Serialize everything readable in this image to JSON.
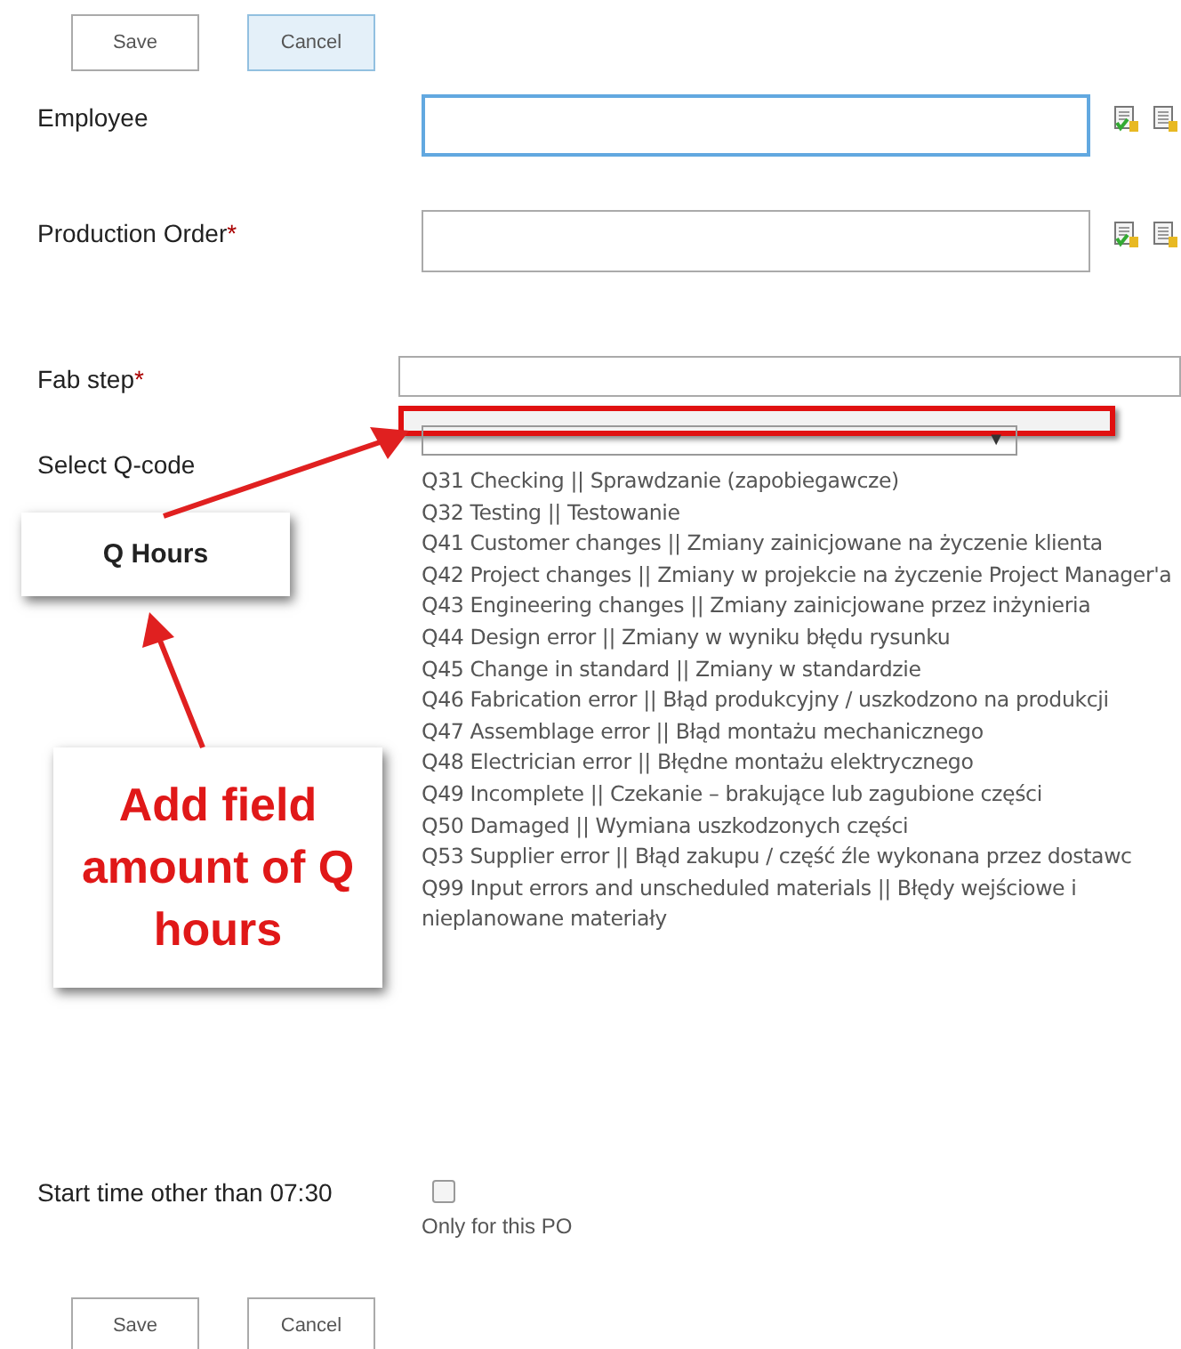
{
  "top_buttons": [
    {
      "label": "Save",
      "hovered": false
    },
    {
      "label": "Cancel",
      "hovered": true
    }
  ],
  "fields": [
    {
      "kind": "people",
      "label": "Employee",
      "focused": true
    },
    {
      "kind": "people",
      "label": "Production Order",
      "required_mark": "*",
      "focused": false
    },
    {
      "kind": "text",
      "label": "Fab step",
      "required_mark": "*",
      "focused": false
    },
    {
      "kind": "choice",
      "label": "Select Q-code",
      "arrow": "▼",
      "options": [
        "Q31 Checking || Sprawdzanie (zapobiegawcze)",
        "Q32 Testing || Testowanie",
        "Q41 Customer changes || Zmiany zainicjowane na życzenie klienta",
        "Q42 Project changes || Zmiany w projekcie na życzenie Project Manager'a",
        "Q43 Engineering changes || Zmiany zainicjowane przez inżynieria",
        "Q44 Design error || Zmiany w wyniku błędu rysunku",
        "Q45 Change in standard || Zmiany w standardzie",
        "Q46 Fabrication error || Błąd produkcyjny / uszkodzono na produkcji",
        "Q47 Assemblage error || Błąd montażu mechanicznego",
        "Q48 Electrician error || Błędne montażu elektrycznego",
        "Q49 Incomplete || Czekanie – brakujące lub zagubione części",
        "Q50 Damaged || Wymiana uszkodzonych części",
        "Q53 Supplier error || Błąd zakupu / część źle wykonana przez dostawc",
        "Q99 Input errors and unscheduled materials || Błędy wejściowe i nieplanowane materiały"
      ]
    },
    {
      "kind": "checkbox",
      "label": "Start time other than 07:30",
      "checked": false,
      "hint": "Only for this PO"
    }
  ],
  "bottom_buttons": [
    {
      "label": "Save",
      "hovered": false
    },
    {
      "label": "Cancel",
      "hovered": false
    }
  ],
  "annotations": {
    "small_note": "Q Hours",
    "big_note": "Add field amount of Q hours"
  }
}
